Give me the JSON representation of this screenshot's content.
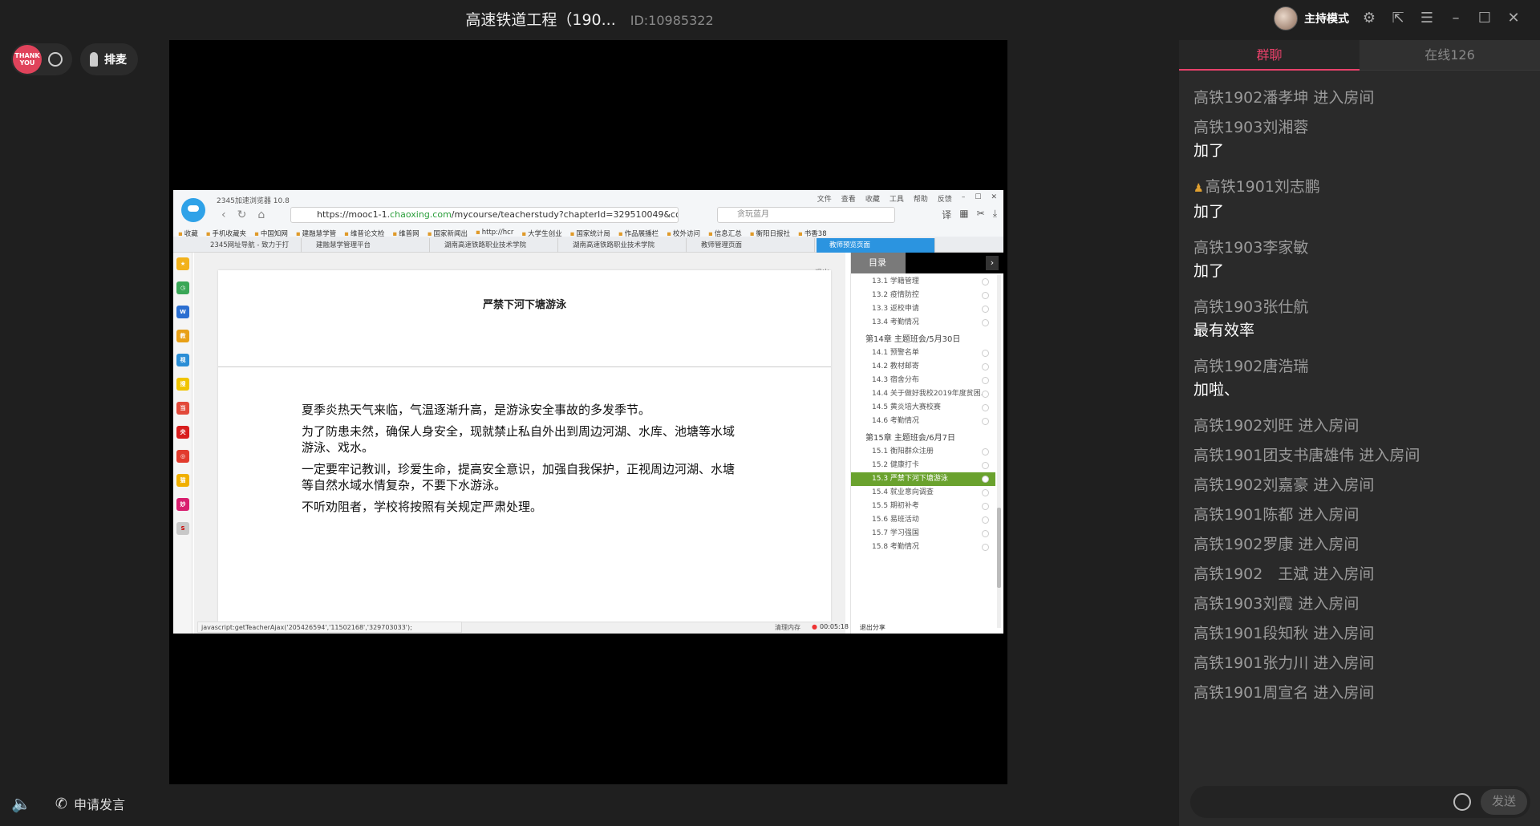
{
  "titlebar": {
    "title": "高速铁道工程（190...",
    "id_text": "ID:10985322",
    "host_mode": "主持模式"
  },
  "left_controls": {
    "avatar_text": "THANK YOU",
    "queue_label": "排麦"
  },
  "bottom_controls": {
    "apply_speak": "申请发言"
  },
  "shared_screen": {
    "browser_name": "2345加速浏览器 10.8",
    "menu": [
      "文件",
      "查看",
      "收藏",
      "工具",
      "帮助",
      "反馈"
    ],
    "url_prefix": "https://mooc1-1.",
    "url_domain": "chaoxing.com",
    "url_rest": "/mycourse/teacherstudy?chapterId=329510049&co",
    "search_text": "贪玩蓝月",
    "bookmarks": [
      "收藏",
      "手机收藏夹",
      "中国知网",
      "建融慧学管",
      "维普论文检",
      "维普网",
      "国家新闻出",
      "http://hcr",
      "大学生创业",
      "国家统计局",
      "作品展播栏",
      "校外访问",
      "信息汇总",
      "衡阳日报社",
      "书香38"
    ],
    "tabs": [
      "2345网址导航 - 致力于打",
      "建融慧学管理平台",
      "湖南高速铁路职业技术学院",
      "湖南高速铁路职业技术学院",
      "教师管理页面",
      "教师预览页面"
    ],
    "exit_label": "退出",
    "doc_title": "严禁下河下塘游泳",
    "doc_paragraphs": [
      "夏季炎热天气来临，气温逐渐升高，是游泳安全事故的多发季节。",
      "为了防患未然，确保人身安全，现就禁止私自外出到周边河湖、水库、池塘等水域游泳、戏水。",
      "一定要牢记教训，珍爱生命，提高安全意识，加强自我保护，正视周边河湖、水塘等自然水域水情复杂，不要下水游泳。",
      "不听劝阻者，学校将按照有关规定严肃处理。"
    ],
    "status_url": "javascript:getTeacherAjax('205426594','11502168','329703033');",
    "catalog_label": "目录",
    "catalog": [
      {
        "kind": "item",
        "text": "13.1 学籍管理"
      },
      {
        "kind": "item",
        "text": "13.2 疫情防控"
      },
      {
        "kind": "item",
        "text": "13.3 返校申请"
      },
      {
        "kind": "item",
        "text": "13.4 考勤情况"
      },
      {
        "kind": "head",
        "text": "第14章 主题班会/5月30日"
      },
      {
        "kind": "item",
        "text": "14.1 预警名单"
      },
      {
        "kind": "item",
        "text": "14.2 教材邮寄"
      },
      {
        "kind": "item",
        "text": "14.3 宿舍分布"
      },
      {
        "kind": "item",
        "text": "14.4 关于做好我校2019年度贫困..."
      },
      {
        "kind": "item",
        "text": "14.5 黄炎培大赛校赛"
      },
      {
        "kind": "item",
        "text": "14.6 考勤情况"
      },
      {
        "kind": "head",
        "text": "第15章 主题班会/6月7日"
      },
      {
        "kind": "item",
        "text": "15.1 衡阳群众注册"
      },
      {
        "kind": "item",
        "text": "15.2 健康打卡"
      },
      {
        "kind": "active",
        "text": "15.3 严禁下河下塘游泳"
      },
      {
        "kind": "item",
        "text": "15.4 就业意向调查"
      },
      {
        "kind": "item",
        "text": "15.5 期初补考"
      },
      {
        "kind": "item",
        "text": "15.6 易班活动"
      },
      {
        "kind": "item",
        "text": "15.7 学习强国"
      },
      {
        "kind": "item",
        "text": "15.8 考勤情况"
      }
    ],
    "status_clean": "清理内存",
    "status_time": "00:05:18",
    "status_stop": "退出分享"
  },
  "chat": {
    "tab_group": "群聊",
    "tab_online": "在线126",
    "messages": [
      {
        "who": "高铁1902潘孝坤 进入房间",
        "body": ""
      },
      {
        "who": "高铁1903刘湘蓉",
        "body": "加了"
      },
      {
        "who": "高铁1901刘志鹏",
        "body": "加了",
        "mod": true
      },
      {
        "who": "高铁1903李家敏",
        "body": "加了"
      },
      {
        "who": "高铁1903张仕航",
        "body": "最有效率"
      },
      {
        "who": "高铁1902唐浩瑞",
        "body": "加啦、"
      },
      {
        "who": "高铁1902刘旺 进入房间",
        "body": ""
      },
      {
        "who": "高铁1901团支书唐雄伟 进入房间",
        "body": ""
      },
      {
        "who": "高铁1902刘嘉豪 进入房间",
        "body": ""
      },
      {
        "who": "高铁1901陈都 进入房间",
        "body": ""
      },
      {
        "who": "高铁1902罗康 进入房间",
        "body": ""
      },
      {
        "who": "高铁1902　王斌 进入房间",
        "body": ""
      },
      {
        "who": "高铁1903刘霞 进入房间",
        "body": ""
      },
      {
        "who": "高铁1901段知秋 进入房间",
        "body": ""
      },
      {
        "who": "高铁1901张力川 进入房间",
        "body": ""
      },
      {
        "who": "高铁1901周宣名 进入房间",
        "body": ""
      }
    ],
    "send_label": "发送",
    "input_placeholder": ""
  }
}
